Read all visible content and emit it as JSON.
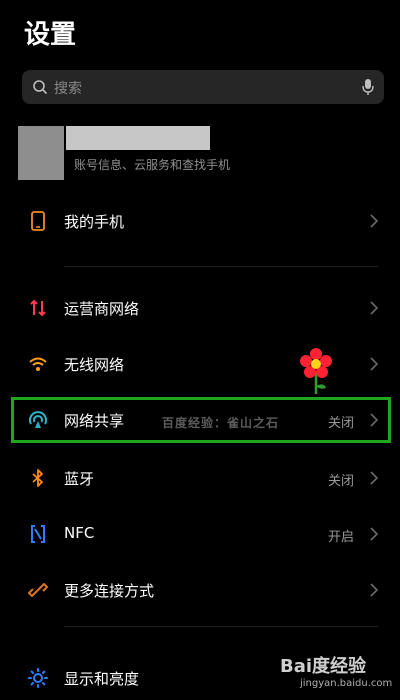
{
  "header": {
    "title": "设置"
  },
  "search": {
    "placeholder": "搜索",
    "icon": "search-icon",
    "mic_icon": "microphone-icon"
  },
  "account": {
    "subtitle": "账号信息、云服务和查找手机"
  },
  "rows": [
    {
      "label": "我的手机",
      "value": "",
      "icon": "phone-icon",
      "color": "#f08a2a"
    },
    {
      "label": "运营商网络",
      "value": "",
      "icon": "carrier-signal-icon",
      "color": "#ff3b4e"
    },
    {
      "label": "无线网络",
      "value": "",
      "icon": "wifi-icon",
      "color": "#ff9f1a"
    },
    {
      "label": "网络共享",
      "value": "关闭",
      "icon": "hotspot-icon",
      "color": "#2bb3c6"
    },
    {
      "label": "蓝牙",
      "value": "关闭",
      "icon": "bluetooth-icon",
      "color": "#ff8c1a"
    },
    {
      "label": "NFC",
      "value": "开启",
      "icon": "nfc-icon",
      "color": "#2f7dff"
    },
    {
      "label": "更多连接方式",
      "value": "",
      "icon": "link-icon",
      "color": "#d9731f"
    },
    {
      "label": "显示和亮度",
      "value": "",
      "icon": "brightness-icon",
      "color": "#2f7dff"
    }
  ],
  "watermark": {
    "text": "百度经验：雀山之石",
    "logo": "Bai度经验",
    "url": "jingyan.baidu.com"
  }
}
